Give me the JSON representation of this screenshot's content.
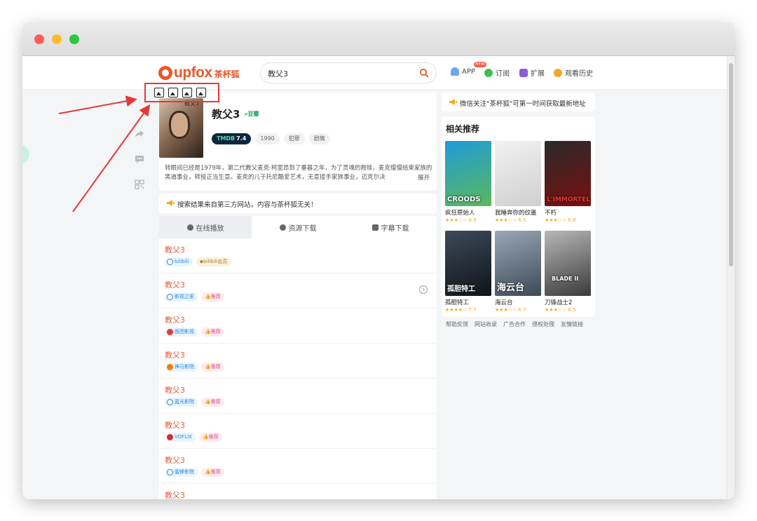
{
  "header": {
    "logo_en": "upfox",
    "logo_cn": "茶杯狐",
    "search": {
      "value": "教父3"
    },
    "nav": {
      "app": "APP",
      "app_badge": "NEW",
      "subscribe": "订阅",
      "extension": "扩展",
      "history": "观看历史"
    }
  },
  "movie": {
    "poster_label": "教父3",
    "title": "教父3",
    "douban_label": "豆瓣",
    "tags": {
      "tmdb_label": "TMDB",
      "tmdb_score": "7.4",
      "year": "1990",
      "genre1": "犯罪",
      "genre2": "剧情"
    },
    "synopsis": "转眼间已经是1979年，第二代教父麦克·柯里昂到了垂暮之年，为了灵魂的救赎，麦克慢慢结束家族的黑道事业，转投正当生意。麦克的儿子托尼酷爱艺术，无意接手家族事业，迈克尔决",
    "expand": "展开"
  },
  "notice": "搜索结果来自第三方网站，内容与茶杯狐无关！",
  "tabs": {
    "play": "在线播放",
    "download": "资源下载",
    "subtitle": "字幕下载"
  },
  "results": [
    {
      "title": "教父3",
      "source": "bilibili",
      "badge": "bilibili会员"
    },
    {
      "title": "教父3",
      "source": "影视之家",
      "badge": "推荐"
    },
    {
      "title": "教父3",
      "source": "饭团影视",
      "badge": "推荐"
    },
    {
      "title": "教父3",
      "source": "神马影院",
      "badge": "推荐"
    },
    {
      "title": "教父3",
      "source": "蓝光影院",
      "badge": "推荐"
    },
    {
      "title": "教父3",
      "source": "VOFLIX",
      "badge": "推荐"
    },
    {
      "title": "教父3",
      "source": "蜜蜂影院",
      "badge": "推荐"
    },
    {
      "title": "教父3"
    }
  ],
  "sidebar": {
    "wechat": "微信关注\"茶杯狐\"可第一时间获取最新地址",
    "reco_title": "相关推荐",
    "recommendations": [
      {
        "title": "疯狂原始人",
        "rating": 6.9,
        "rating_text": "6.9",
        "caption": "CROODS",
        "stars": "★★★☆☆",
        "color1": "#1e9bd7",
        "color2": "#5cb85c"
      },
      {
        "title": "我睡奔你的纹墨",
        "rating": 6.5,
        "rating_text": "6.5",
        "caption": "",
        "stars": "★★★☆☆",
        "color1": "#f2f2f2",
        "color2": "#cfcfcf"
      },
      {
        "title": "不朽",
        "rating": 6.6,
        "rating_text": "6.6",
        "caption": "L'IMMORTEL",
        "stars": "★★★☆☆",
        "color1": "#2a2a2a",
        "color2": "#7a1010"
      },
      {
        "title": "孤胆特工",
        "rating": 7.7,
        "rating_text": "7.7",
        "caption": "孤胆特工",
        "stars": "★★★★☆",
        "color1": "#3b4a5a",
        "color2": "#0f1419"
      },
      {
        "title": "海云台",
        "rating": 6.7,
        "rating_text": "6.7",
        "caption": "海云台",
        "stars": "★★★☆☆",
        "color1": "#9aa8b5",
        "color2": "#3c4a58"
      },
      {
        "title": "刀锋战士2",
        "rating": 6.5,
        "rating_text": "6.5",
        "caption": "BLADE II",
        "stars": "★★★☆☆",
        "color1": "#b8b8b8",
        "color2": "#3a3a3a"
      }
    ]
  },
  "footer": {
    "links": [
      "帮助反馈",
      "网站收录",
      "广告合作",
      "侵权处理",
      "友情链接"
    ]
  },
  "colors": {
    "brand": "#e8582c",
    "link_title": "#e55d3a",
    "annotation": "#e53935"
  }
}
